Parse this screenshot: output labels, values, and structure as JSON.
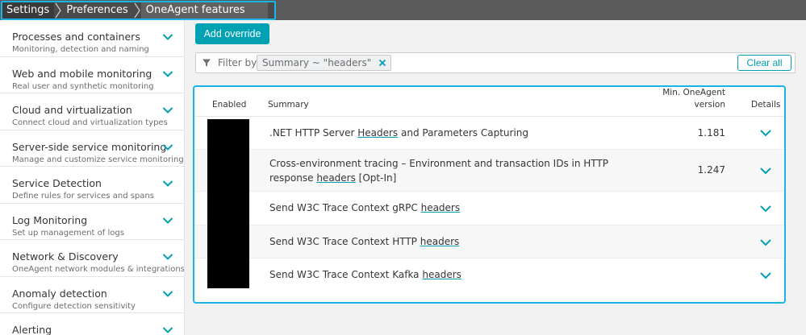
{
  "breadcrumb": [
    "Settings",
    "Preferences",
    "OneAgent features"
  ],
  "sidebar": {
    "items": [
      {
        "title": "Processes and containers",
        "subtitle": "Monitoring, detection and naming"
      },
      {
        "title": "Web and mobile monitoring",
        "subtitle": "Real user and synthetic monitoring"
      },
      {
        "title": "Cloud and virtualization",
        "subtitle": "Connect cloud and virtualization types"
      },
      {
        "title": "Server-side service monitoring",
        "subtitle": "Manage and customize service monitoring"
      },
      {
        "title": "Service Detection",
        "subtitle": "Define rules for services and spans"
      },
      {
        "title": "Log Monitoring",
        "subtitle": "Set up management of logs"
      },
      {
        "title": "Network & Discovery",
        "subtitle": "OneAgent network modules & integrations"
      },
      {
        "title": "Anomaly detection",
        "subtitle": "Configure detection sensitivity"
      },
      {
        "title": "Alerting",
        "subtitle": ""
      }
    ]
  },
  "toolbar": {
    "add_override_label": "Add override"
  },
  "filter": {
    "label": "Filter by",
    "chip": "Summary ~ \"headers\"",
    "clear_label": "Clear all"
  },
  "table": {
    "headers": {
      "enabled": "Enabled",
      "summary": "Summary",
      "version_line1": "Min. OneAgent",
      "version_line2": "version",
      "details": "Details"
    },
    "rows": [
      {
        "pre": ".NET HTTP Server ",
        "hl": "Headers",
        "post": " and Parameters Capturing",
        "version": "1.181"
      },
      {
        "pre": "Cross-environment tracing – Environment and transaction IDs in HTTP response ",
        "hl": "headers",
        "post": " [Opt-In]",
        "version": "1.247"
      },
      {
        "pre": "Send W3C Trace Context gRPC ",
        "hl": "headers",
        "post": "",
        "version": ""
      },
      {
        "pre": "Send W3C Trace Context HTTP ",
        "hl": "headers",
        "post": "",
        "version": ""
      },
      {
        "pre": "Send W3C Trace Context Kafka ",
        "hl": "headers",
        "post": "",
        "version": ""
      }
    ]
  },
  "colors": {
    "accent": "#00a1b2",
    "highlight_border": "#1ab4e6",
    "topbar": "#5a5a5a"
  },
  "icons": {
    "filter": "filter-icon",
    "chevron": "chevron-down-icon",
    "close": "close-icon"
  }
}
